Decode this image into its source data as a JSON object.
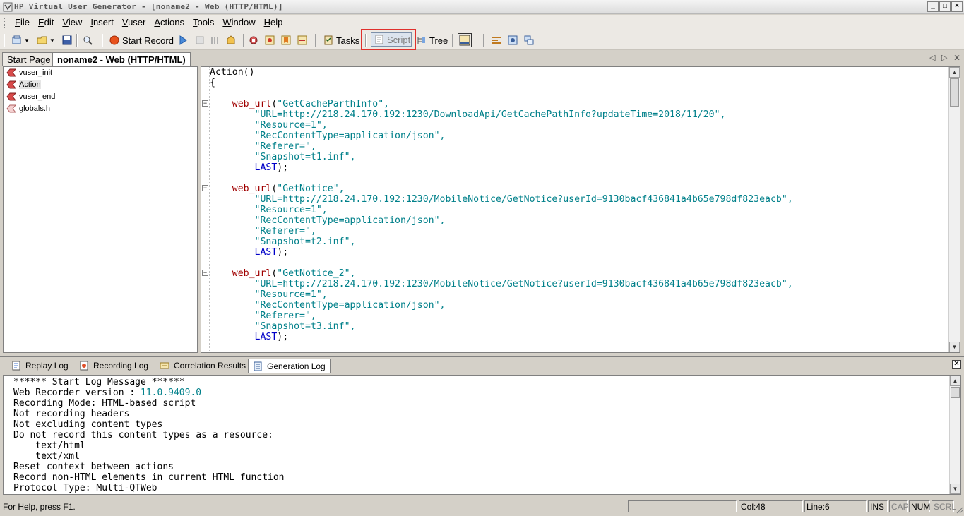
{
  "window": {
    "title": "HP Virtual User Generator - [noname2 - Web (HTTP/HTML)]",
    "controls": [
      "_",
      "□",
      "×"
    ]
  },
  "menu": [
    "File",
    "Edit",
    "View",
    "Insert",
    "Vuser",
    "Actions",
    "Tools",
    "Window",
    "Help"
  ],
  "toolbar": {
    "start_record": "Start Record",
    "tasks": "Tasks",
    "script": "Script",
    "tree": "Tree"
  },
  "doc_tabs": {
    "start_page": "Start Page",
    "active": "noname2 - Web (HTTP/HTML)"
  },
  "tree": {
    "items": [
      "vuser_init",
      "Action",
      "vuser_end",
      "globals.h"
    ],
    "selected": "Action"
  },
  "editor": {
    "header": [
      "Action()",
      "{"
    ],
    "blocks": [
      {
        "call": "web_url",
        "name": "\"GetCacheParthInfo\",",
        "args": [
          "\"URL=http://218.24.170.192:1230/DownloadApi/GetCachePathInfo?updateTime=2018/11/20\",",
          "\"Resource=1\",",
          "\"RecContentType=application/json\",",
          "\"Referer=\",",
          "\"Snapshot=t1.inf\","
        ],
        "end": "LAST",
        "end_tail": ");"
      },
      {
        "call": "web_url",
        "name": "\"GetNotice\",",
        "args": [
          "\"URL=http://218.24.170.192:1230/MobileNotice/GetNotice?userId=9130bacf436841a4b65e798df823eacb\",",
          "\"Resource=1\",",
          "\"RecContentType=application/json\",",
          "\"Referer=\",",
          "\"Snapshot=t2.inf\","
        ],
        "end": "LAST",
        "end_tail": ");"
      },
      {
        "call": "web_url",
        "name": "\"GetNotice_2\",",
        "args": [
          "\"URL=http://218.24.170.192:1230/MobileNotice/GetNotice?userId=9130bacf436841a4b65e798df823eacb\",",
          "\"Resource=1\",",
          "\"RecContentType=application/json\",",
          "\"Referer=\",",
          "\"Snapshot=t3.inf\","
        ],
        "end": "LAST",
        "end_tail": ");"
      }
    ]
  },
  "output_tabs": [
    "Replay Log",
    "Recording Log",
    "Correlation Results",
    "Generation Log"
  ],
  "output_active": "Generation Log",
  "log": {
    "line1": "****** Start Log Message ******",
    "line2_prefix": "Web Recorder version : ",
    "line2_value": "11.0.9409.0",
    "lines": [
      "Recording Mode: HTML-based script",
      "Not recording headers",
      "Not excluding content types",
      "Do not record this content types as a resource:",
      "    text/html",
      "    text/xml",
      "Reset context between actions",
      "Record non-HTML elements in current HTML function",
      "Protocol Type: Multi-QTWeb"
    ]
  },
  "status": {
    "help": "For Help, press F1.",
    "col": "Col:48",
    "line": "Line:6",
    "ins": "INS",
    "cap": "CAP",
    "num": "NUM",
    "scrl": "SCRL"
  },
  "colors": {
    "function": "#a00000",
    "string": "#00808a",
    "keyword": "#0000c8",
    "highlight_border": "#e0302c"
  }
}
